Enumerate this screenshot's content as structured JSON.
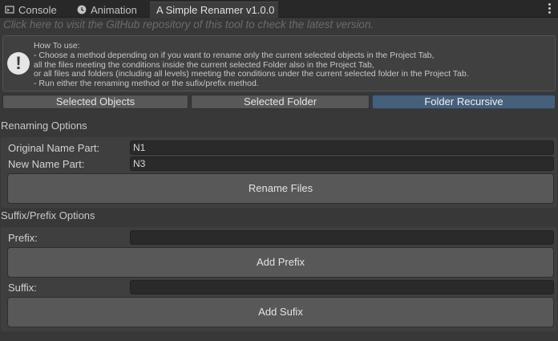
{
  "tabs": {
    "console": "Console",
    "animation": "Animation",
    "renamer": "A Simple Renamer v1.0.0"
  },
  "github_link": "Click here to visit the GitHub repository of this tool to check the latest version.",
  "help": {
    "lines": [
      "How To use:",
      "- Choose a method depending on if you want to rename only the current selected objects in the Project Tab,",
      "all the files meeting the conditions inside the current selected Folder also in the Project Tab,",
      "or all files and folders (including all levels) meeting the conditions under the current selected folder in the Project Tab.",
      "- Run either the renaming method or the sufix/prefix method."
    ]
  },
  "modes": {
    "selected_objects": "Selected Objects",
    "selected_folder": "Selected Folder",
    "folder_recursive": "Folder Recursive",
    "active": "Folder Recursive"
  },
  "renaming": {
    "title": "Renaming Options",
    "original_label": "Original Name Part:",
    "original_value": "N1",
    "new_label": "New Name Part:",
    "new_value": "N3",
    "button": "Rename Files"
  },
  "affix": {
    "title": "Suffix/Prefix Options",
    "prefix_label": "Prefix:",
    "prefix_value": "",
    "prefix_button": "Add Prefix",
    "suffix_label": "Suffix:",
    "suffix_value": "",
    "suffix_button": "Add Sufix"
  },
  "colors": {
    "background": "#383838",
    "active_mode": "#46607c",
    "button": "#585858"
  }
}
